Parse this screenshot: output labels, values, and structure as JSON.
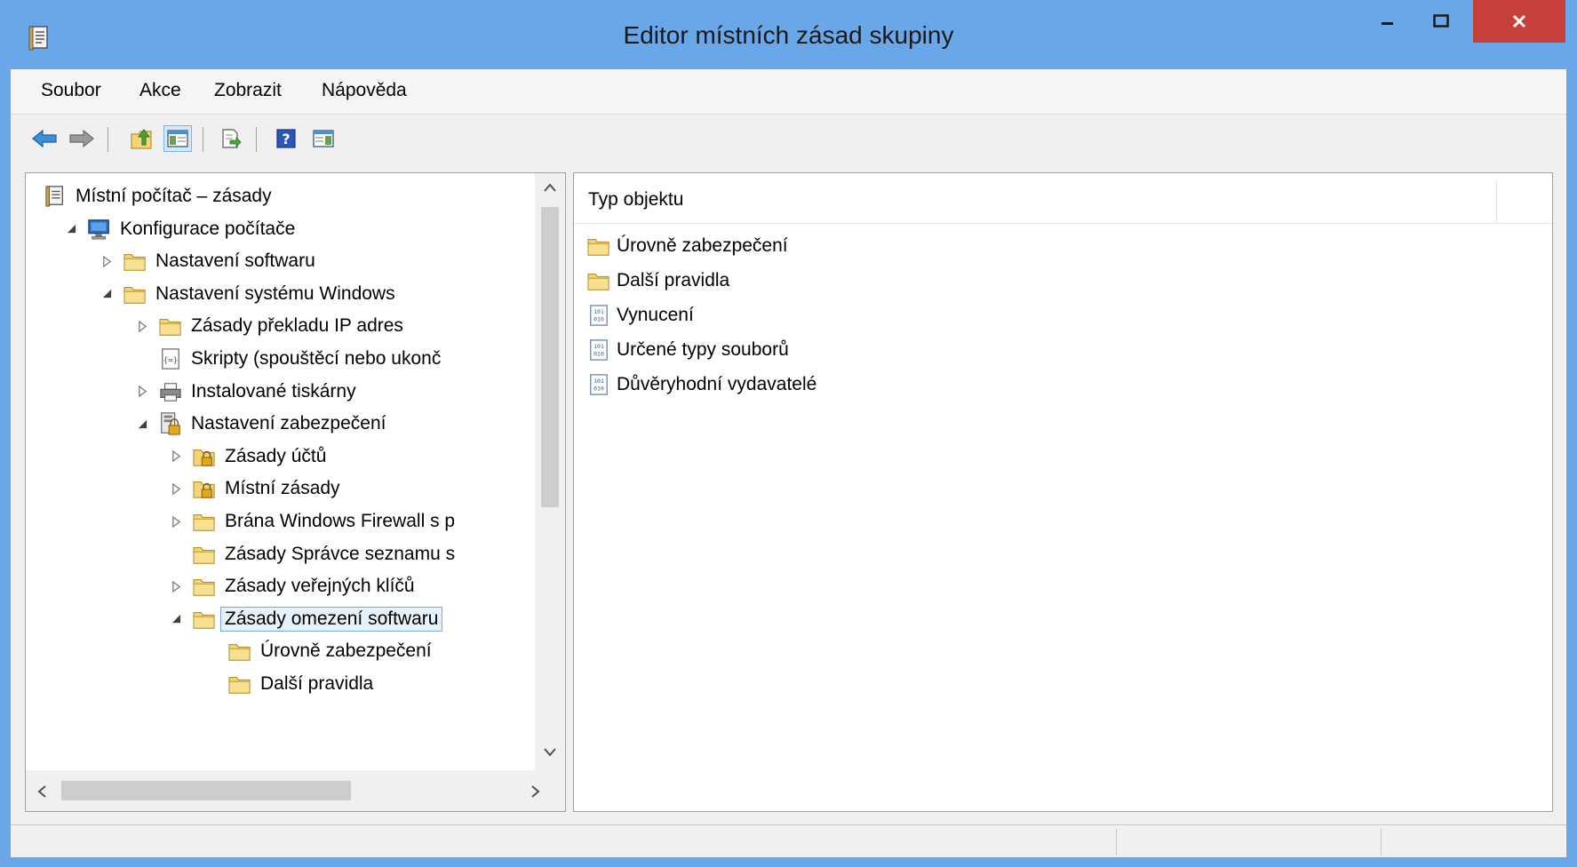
{
  "window": {
    "title": "Editor místních zásad skupiny",
    "colors": {
      "frame": "#6aa7e8",
      "close": "#c7413b",
      "selection": "#e5f1fb",
      "folder": "#f2d675"
    }
  },
  "menu": [
    "Soubor",
    "Akce",
    "Zobrazit",
    "Nápověda"
  ],
  "toolbar": [
    "back-arrow-icon",
    "forward-arrow-icon",
    "up-folder-icon",
    "show-hide-tree-icon",
    "export-list-icon",
    "help-icon",
    "action-pane-icon"
  ],
  "tree": {
    "items": [
      {
        "label": "Místní počítač – zásady",
        "icon": "policy-icon",
        "expander": "none",
        "level": 0
      },
      {
        "label": "Konfigurace počítače",
        "icon": "computer-icon",
        "expander": "expanded",
        "level": 1
      },
      {
        "label": "Nastavení softwaru",
        "icon": "folder-icon",
        "expander": "collapsed",
        "level": 2
      },
      {
        "label": "Nastavení systému Windows",
        "icon": "folder-icon",
        "expander": "expanded",
        "level": 2
      },
      {
        "label": "Zásady překladu IP adres",
        "icon": "folder-icon",
        "expander": "collapsed",
        "level": 3
      },
      {
        "label": "Skripty (spouštěcí nebo ukonč",
        "icon": "script-icon",
        "expander": "none",
        "level": 3
      },
      {
        "label": "Instalované tiskárny",
        "icon": "printer-icon",
        "expander": "collapsed",
        "level": 3
      },
      {
        "label": "Nastavení zabezpečení",
        "icon": "security-icon",
        "expander": "expanded",
        "level": 3
      },
      {
        "label": "Zásady účtů",
        "icon": "locked-folder-icon",
        "expander": "collapsed",
        "level": 4
      },
      {
        "label": "Místní zásady",
        "icon": "locked-folder-icon",
        "expander": "collapsed",
        "level": 4
      },
      {
        "label": "Brána Windows Firewall s p",
        "icon": "folder-icon",
        "expander": "collapsed",
        "level": 4
      },
      {
        "label": "Zásady Správce seznamu s",
        "icon": "folder-icon",
        "expander": "none",
        "level": 4
      },
      {
        "label": "Zásady veřejných klíčů",
        "icon": "folder-icon",
        "expander": "collapsed",
        "level": 4
      },
      {
        "label": "Zásady omezení softwaru",
        "icon": "folder-icon",
        "expander": "expanded",
        "level": 4,
        "selected": true
      },
      {
        "label": "Úrovně zabezpečení",
        "icon": "folder-icon",
        "expander": "none",
        "level": 5
      },
      {
        "label": "Další pravidla",
        "icon": "folder-icon",
        "expander": "none",
        "level": 5
      }
    ]
  },
  "list": {
    "column": "Typ objektu",
    "items": [
      {
        "label": "Úrovně zabezpečení",
        "icon": "folder-icon"
      },
      {
        "label": "Další pravidla",
        "icon": "folder-icon"
      },
      {
        "label": "Vynucení",
        "icon": "binary-policy-icon"
      },
      {
        "label": "Určené typy souborů",
        "icon": "binary-policy-icon"
      },
      {
        "label": "Důvěryhodní vydavatelé",
        "icon": "binary-policy-icon"
      }
    ]
  }
}
